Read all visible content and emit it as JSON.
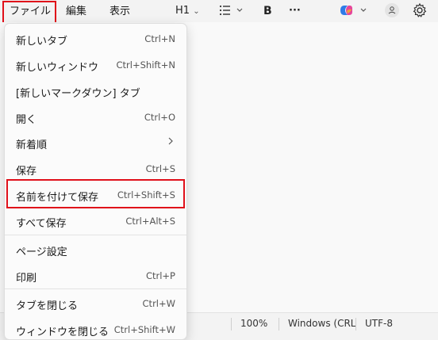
{
  "menubar": {
    "file": "ファイル",
    "edit": "編集",
    "view": "表示",
    "heading": "H1",
    "bold": "B",
    "more": "···"
  },
  "statusbar": {
    "zoom": "100%",
    "line_ending": "Windows (CRL",
    "encoding": "UTF-8"
  },
  "file_menu": {
    "items": [
      {
        "label": "新しいタブ",
        "shortcut": "Ctrl+N"
      },
      {
        "label": "新しいウィンドウ",
        "shortcut": "Ctrl+Shift+N"
      },
      {
        "label": "[新しいマークダウン] タブ",
        "shortcut": ""
      },
      {
        "label": "開く",
        "shortcut": "Ctrl+O"
      },
      {
        "label": "新着順",
        "shortcut": ""
      },
      {
        "label": "保存",
        "shortcut": "Ctrl+S"
      },
      {
        "label": "名前を付けて保存",
        "shortcut": "Ctrl+Shift+S"
      },
      {
        "label": "すべて保存",
        "shortcut": "Ctrl+Alt+S"
      },
      {
        "label": "ページ設定",
        "shortcut": ""
      },
      {
        "label": "印刷",
        "shortcut": "Ctrl+P"
      },
      {
        "label": "タブを閉じる",
        "shortcut": "Ctrl+W"
      },
      {
        "label": "ウィンドウを閉じる",
        "shortcut": "Ctrl+Shift+W"
      }
    ]
  },
  "colors": {
    "highlight": "#e0101a",
    "menu_bg": "#fbfbfb"
  }
}
